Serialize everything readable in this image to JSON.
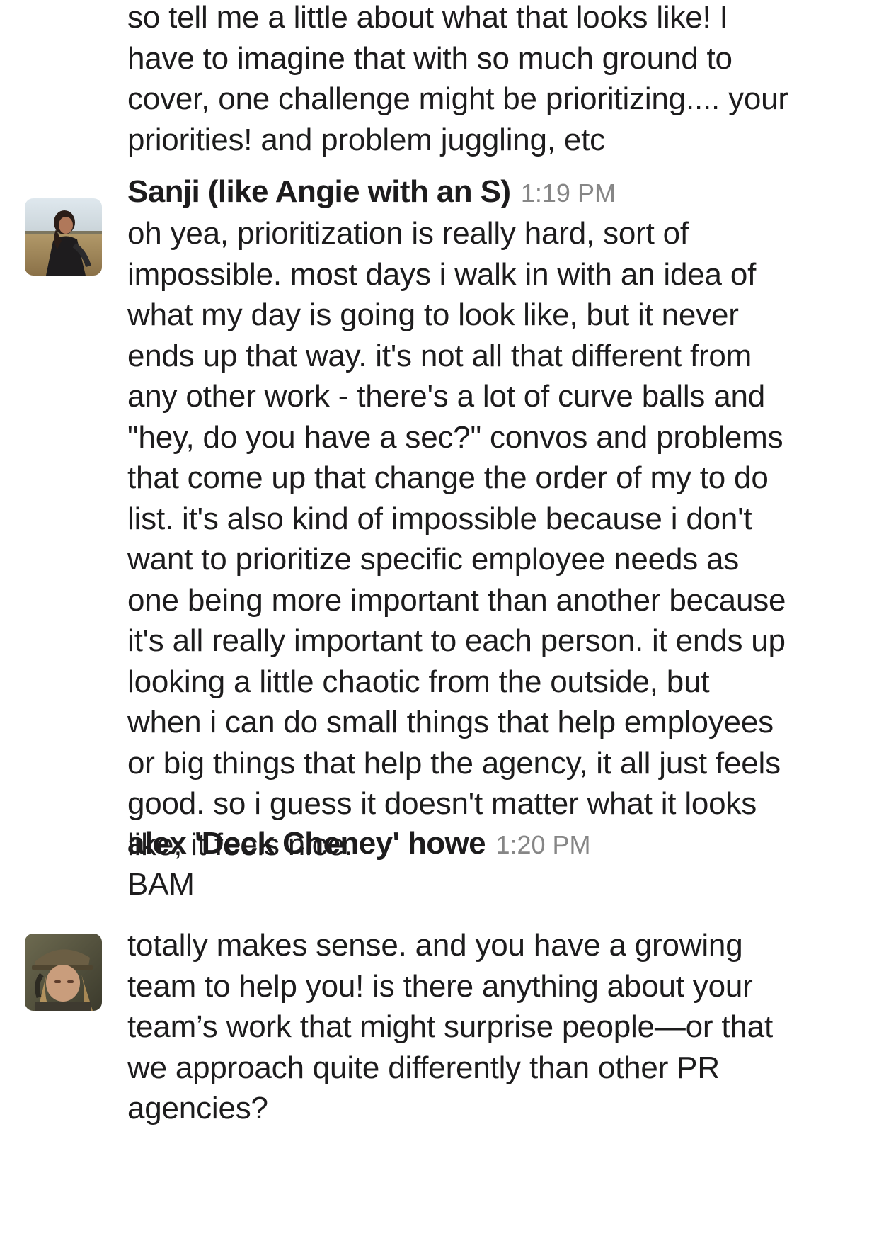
{
  "messages": {
    "first": {
      "lines": [
        "so tell me a little about what that looks like! I",
        "have to imagine that with so much ground to",
        "cover, one challenge might be prioritizing.... your",
        "priorities! and problem juggling, etc"
      ]
    },
    "second": {
      "sender": "Sanji (like Angie with an S)",
      "time": "1:19 PM",
      "lines": [
        "oh yea, prioritization is really hard, sort of",
        "impossible. most days i walk in with an idea of",
        "what my day is going to look like, but it never",
        "ends up that way. it's not all that different from",
        "any other work - there's a lot of curve balls and",
        "\"hey, do you have a sec?\" convos and problems",
        "that come up that change the order of my to do",
        "list. it's also kind of impossible because i don't",
        "want to prioritize specific employee needs as",
        "one being more important than another because",
        "it's all really important to each person. it ends up",
        "looking a little chaotic from the outside, but",
        "when i can do small things that help employees",
        "or big things that help the agency, it all just feels",
        "good. so i guess it doesn't matter what it looks",
        "like, it feels nice."
      ]
    },
    "third": {
      "sender": "alex 'Deck Cheney' howe",
      "time": "1:20 PM",
      "first_line": "BAM",
      "lines": [
        "totally makes sense. and you have a growing",
        "team to help you! is there anything about your",
        "team’s work that might surprise people—or that",
        "we approach quite differently than other PR",
        "agencies?"
      ]
    }
  },
  "colors": {
    "text": "#1d1c1d",
    "timestamp": "#868686",
    "background": "#ffffff"
  },
  "icons": {
    "avatar_sanji": "avatar-photo-woman-field",
    "avatar_alex": "avatar-photo-woman-cap"
  }
}
